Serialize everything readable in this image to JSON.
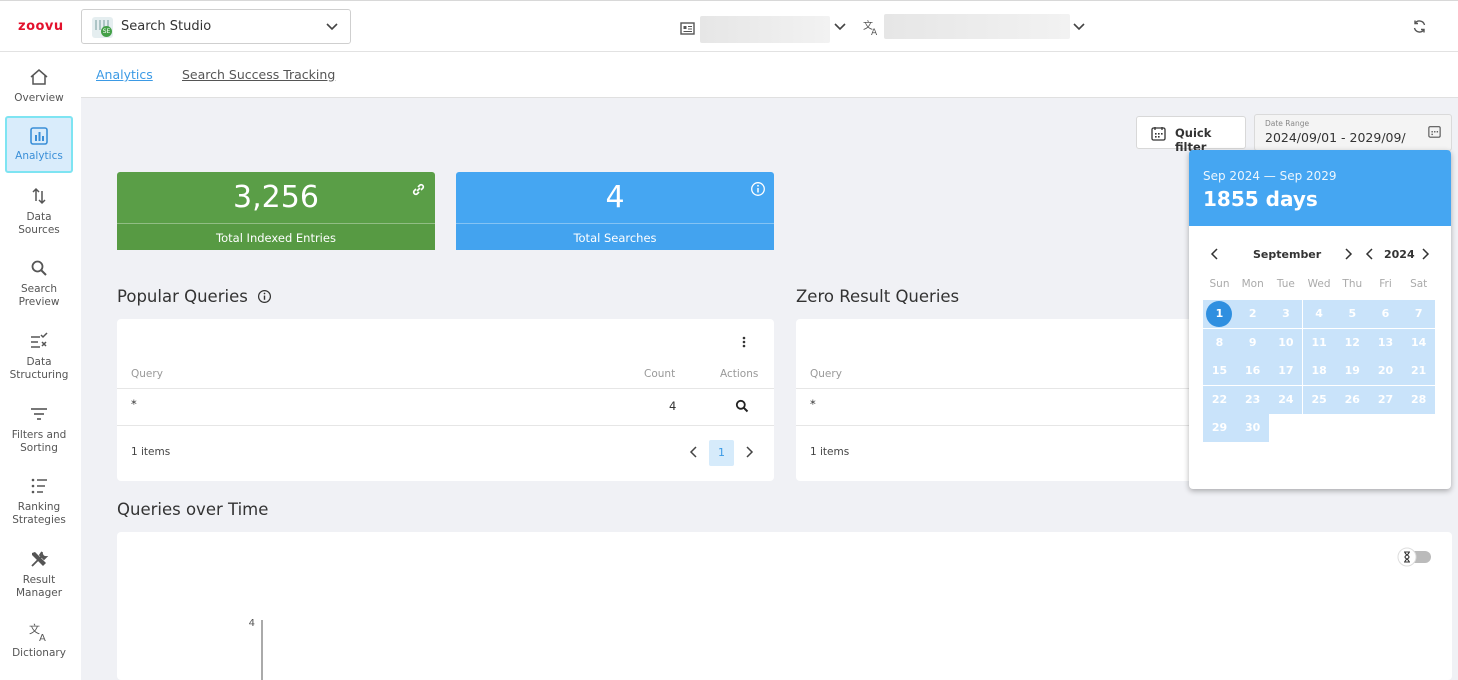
{
  "brand": {
    "logo_text": "ZOOVU",
    "color": "#e3122d"
  },
  "app_selector": {
    "label": "Search Studio",
    "icon": "search-studio-app-icon",
    "badge": "SE"
  },
  "topbar": {
    "environment_icon": "environment-icon",
    "language_icon": "translate-icon",
    "refresh_icon": "refresh-icon"
  },
  "sidebar": {
    "items": [
      {
        "label": "Overview",
        "icon": "home-icon"
      },
      {
        "label": "Analytics",
        "icon": "bar-chart-icon",
        "active": true
      },
      {
        "label": "Data Sources",
        "icon": "swap-vertical-icon"
      },
      {
        "label": "Search Preview",
        "icon": "search-icon"
      },
      {
        "label": "Data Structuring",
        "icon": "list-check-icon"
      },
      {
        "label": "Filters and Sorting",
        "icon": "filter-icon"
      },
      {
        "label": "Ranking Strategies",
        "icon": "ranked-list-icon"
      },
      {
        "label": "Result Manager",
        "icon": "tools-icon"
      },
      {
        "label": "Dictionary",
        "icon": "translate-icon"
      }
    ]
  },
  "tabs": [
    {
      "label": "Analytics",
      "active": true
    },
    {
      "label": "Search Success Tracking",
      "active": false
    }
  ],
  "filters": {
    "quick_filter_label": "Quick filter",
    "date_range_caption": "Date Range",
    "date_range_value": "2024/09/01 - 2029/09/"
  },
  "kpis": [
    {
      "value": "3,256",
      "label": "Total Indexed Entries",
      "icon": "link-icon",
      "color": "#5a9e47"
    },
    {
      "value": "4",
      "label": "Total Searches",
      "icon": "info-icon",
      "color": "#45a6f2"
    }
  ],
  "popular_queries": {
    "title": "Popular Queries",
    "columns": [
      "Query",
      "Count",
      "Actions"
    ],
    "rows": [
      {
        "query": "*",
        "count": "4"
      }
    ],
    "items_text": "1 items",
    "current_page": "1"
  },
  "zero_result_queries": {
    "title": "Zero Result Queries",
    "columns": [
      "Query"
    ],
    "rows": [
      {
        "query": "*"
      }
    ],
    "items_text": "1 items"
  },
  "queries_over_time": {
    "title": "Queries over Time"
  },
  "chart_data": {
    "type": "line",
    "title": "Queries over Time",
    "y_ticks": [
      "4"
    ],
    "x": [],
    "series": []
  },
  "calendar": {
    "range_text": "Sep 2024 — Sep 2029",
    "days_text": "1855 days",
    "month": "September",
    "year": "2024",
    "weekdays": [
      "Sun",
      "Mon",
      "Tue",
      "Wed",
      "Thu",
      "Fri",
      "Sat"
    ],
    "days": [
      "1",
      "2",
      "3",
      "4",
      "5",
      "6",
      "7",
      "8",
      "9",
      "10",
      "11",
      "12",
      "13",
      "14",
      "15",
      "16",
      "17",
      "18",
      "19",
      "20",
      "21",
      "22",
      "23",
      "24",
      "25",
      "26",
      "27",
      "28",
      "29",
      "30"
    ],
    "selected_day": "1",
    "accent": "#45a6f2"
  }
}
